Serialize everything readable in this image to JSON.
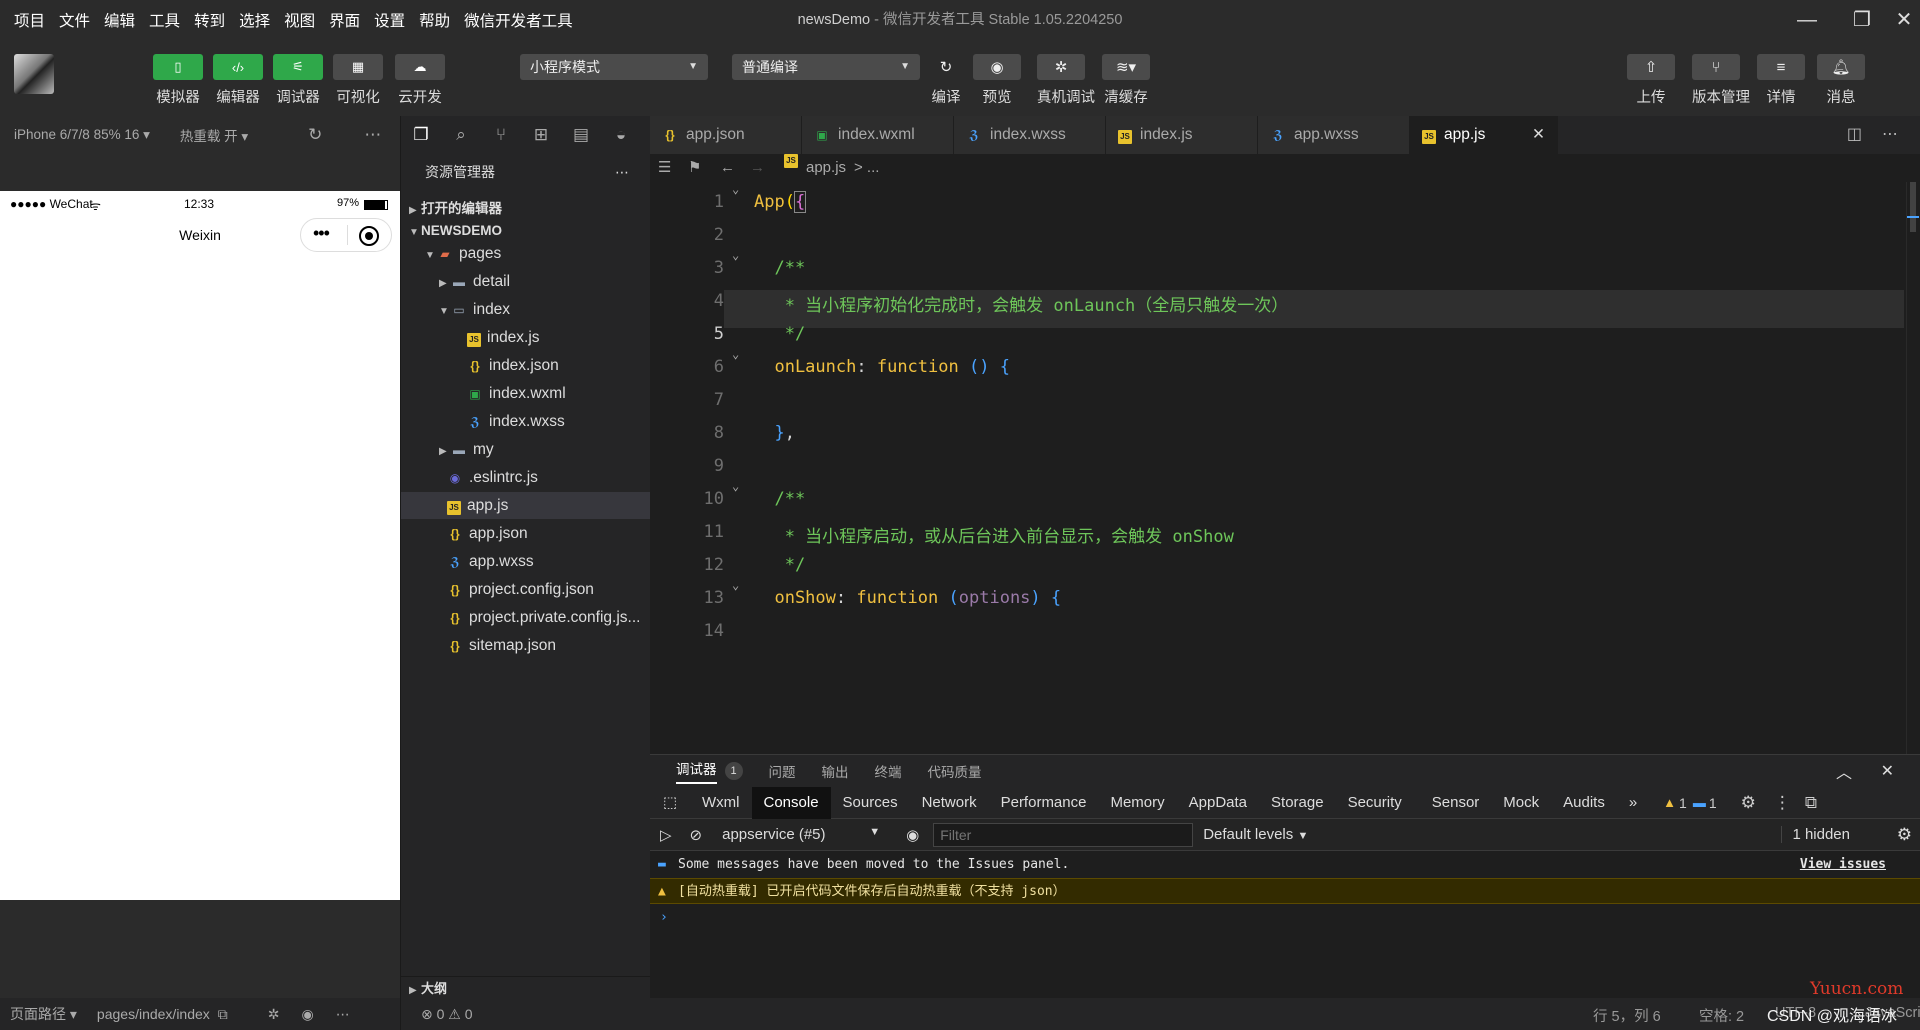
{
  "menu": [
    "项目",
    "文件",
    "编辑",
    "工具",
    "转到",
    "选择",
    "视图",
    "界面",
    "设置",
    "帮助",
    "微信开发者工具"
  ],
  "window": {
    "project": "newsDemo",
    "sep": " - ",
    "app": "微信开发者工具 Stable 1.05.2204250"
  },
  "toolbar": {
    "simulator": "模拟器",
    "editor": "编辑器",
    "debugger": "调试器",
    "visual": "可视化",
    "cloud": "云开发",
    "mode": "小程序模式",
    "compile_mode": "普通编译",
    "compile": "编译",
    "preview": "预览",
    "remote_debug": "真机调试",
    "clear_cache": "清缓存",
    "upload": "上传",
    "version": "版本管理",
    "details": "详情",
    "messages": "消息"
  },
  "simulator": {
    "device": "iPhone 6/7/8 85% 16 ▾",
    "hot_reload": "热重载 开 ▾",
    "carrier": "●●●●● WeChat",
    "time": "12:33",
    "battery": "97%",
    "nav_title": "Weixin",
    "footer_path_label": "页面路径 ▾",
    "footer_path": "pages/index/index"
  },
  "explorer": {
    "title": "资源管理器",
    "open_editors": "打开的编辑器",
    "project": "NEWSDEMO",
    "items": [
      {
        "label": "pages",
        "type": "folder-open"
      },
      {
        "label": "detail",
        "type": "folder"
      },
      {
        "label": "index",
        "type": "folder-open"
      },
      {
        "label": "index.js",
        "type": "js"
      },
      {
        "label": "index.json",
        "type": "json"
      },
      {
        "label": "index.wxml",
        "type": "wxml"
      },
      {
        "label": "index.wxss",
        "type": "wxss"
      },
      {
        "label": "my",
        "type": "folder"
      },
      {
        "label": ".eslintrc.js",
        "type": "eslint"
      },
      {
        "label": "app.js",
        "type": "js"
      },
      {
        "label": "app.json",
        "type": "json"
      },
      {
        "label": "app.wxss",
        "type": "wxss"
      },
      {
        "label": "project.config.json",
        "type": "json"
      },
      {
        "label": "project.private.config.js...",
        "type": "json"
      },
      {
        "label": "sitemap.json",
        "type": "json"
      }
    ],
    "outline": "大纲",
    "errors": "⊗ 0 ⚠ 0"
  },
  "tabs": [
    {
      "label": "app.json",
      "type": "json"
    },
    {
      "label": "index.wxml",
      "type": "wxml"
    },
    {
      "label": "index.wxss",
      "type": "wxss"
    },
    {
      "label": "index.js",
      "type": "js"
    },
    {
      "label": "app.wxss",
      "type": "wxss"
    },
    {
      "label": "app.js",
      "type": "js",
      "active": true
    }
  ],
  "breadcrumb": {
    "file": "app.js",
    "rest": "> ..."
  },
  "code": {
    "line_numbers": [
      "1",
      "2",
      "3",
      "4",
      "5",
      "6",
      "7",
      "8",
      "9",
      "10",
      "11",
      "12",
      "13",
      "14"
    ],
    "current_line": "5"
  },
  "debug": {
    "panel_tabs": [
      "调试器",
      "问题",
      "输出",
      "终端",
      "代码质量"
    ],
    "badge": "1",
    "dev_tabs": [
      "Wxml",
      "Console",
      "Sources",
      "Network",
      "Performance",
      "Memory",
      "AppData",
      "Storage",
      "Security",
      "Sensor",
      "Mock",
      "Audits"
    ],
    "warn_count": "1",
    "info_count": "1",
    "context": "appservice (#5)",
    "filter_placeholder": "Filter",
    "levels": "Default levels",
    "hidden": "1 hidden",
    "msg_info": "Some messages have been moved to the Issues panel.",
    "msg_link": "View issues",
    "msg_warn": "[自动热重载] 已开启代码文件保存后自动热重载（不支持 json）",
    "prompt": "›"
  },
  "status": {
    "position": "行 5，列 6",
    "spaces": "空格: 2",
    "encoding": "UTF-8",
    "lang": "JavaScript",
    "watermark1": "Yuucn.com",
    "watermark2": "CSDN @观海语冰"
  },
  "colors": {
    "accent_green": "#2fa84a",
    "comment": "#6ec65a",
    "keyword": "#f0c040"
  }
}
